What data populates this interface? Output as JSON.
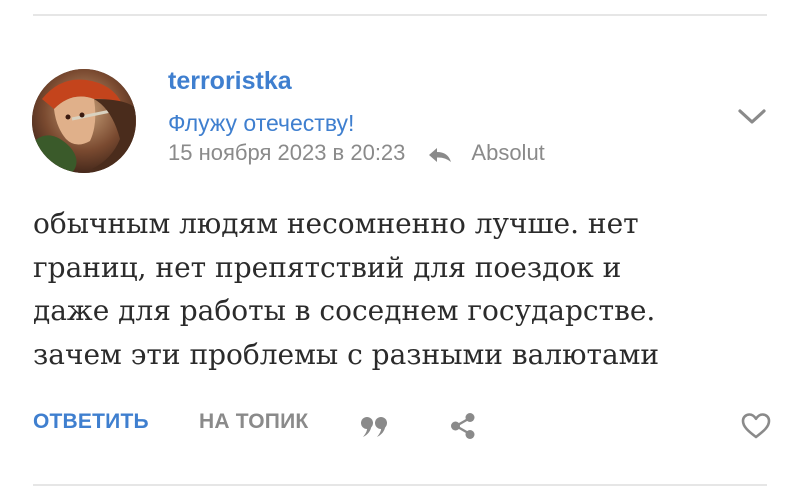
{
  "post": {
    "username": "terroristka",
    "status": "Флужу отечеству!",
    "timestamp": "15 ноября 2023 в 20:23",
    "reply_to": "Absolut",
    "body_lines": [
      "обычным людям несомненно лучше. нет",
      "границ, нет препятствий для поездок и",
      "даже для работы в соседнем государстве.",
      "зачем эти проблемы с разными валютами"
    ]
  },
  "actions": {
    "reply_label": "ОТВЕТИТЬ",
    "topic_label": "НА ТОПИК"
  },
  "icons": {
    "reply_arrow": "reply-arrow-icon",
    "chevron": "chevron-down-icon",
    "quote": "quote-icon",
    "share": "share-icon",
    "like": "heart-icon"
  },
  "colors": {
    "accent": "#3f7fcf",
    "muted": "#8a8a8a",
    "text": "#2b2b2b",
    "divider": "#e6e6e6"
  }
}
